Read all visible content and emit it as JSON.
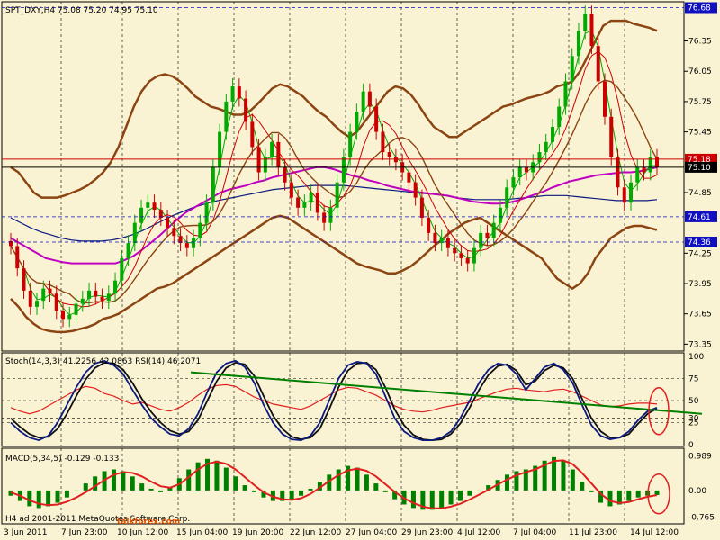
{
  "colors": {
    "background": "#FAF3D3",
    "grid": "#000000",
    "bull": "#00AA00",
    "bear": "#CC0000",
    "bollinger": "#8B4513",
    "ma_slow": "#C000C0",
    "ma_long": "#0A1A80",
    "env_red": "#E02020",
    "stoch_main": "#0A1A80",
    "stoch_signal": "#101010",
    "rsi": "#E02020",
    "trend": "#008000",
    "macd_hist": "#008000",
    "macd_signal": "#E02020",
    "level_line": "#1010C0",
    "marker": "#E02020",
    "hline_black": "#000000",
    "hline_red": "#CC0000"
  },
  "panels": {
    "main": {
      "title": "SPT_DXY,H4  75.08 75.20 74.95 75.10",
      "price_labels": [
        "76.35",
        "76.05",
        "75.75",
        "75.45",
        "74.85",
        "74.25",
        "73.95",
        "73.65",
        "73.35"
      ],
      "badges": [
        {
          "value": "76.68",
          "color": "#1010C0"
        },
        {
          "value": "75.18",
          "color": "#CC0000"
        },
        {
          "value": "75.10",
          "color": "#000000"
        },
        {
          "value": "74.61",
          "color": "#1010C0"
        },
        {
          "value": "74.36",
          "color": "#1010C0"
        }
      ]
    },
    "stoch": {
      "title": "Stoch(14,3,3) 41.2256 42.0863  RSI(14) 46.2071",
      "levels": [
        "100",
        "75",
        "50",
        "30",
        "25",
        "0"
      ]
    },
    "macd": {
      "title": "MACD(5,34,5) -0.129 -0.133",
      "levels": [
        "0.989",
        "0.00",
        "-0.765"
      ]
    }
  },
  "x_axis": {
    "labels": [
      "3 Jun 2011",
      "7 Jun 23:00",
      "10 Jun 12:00",
      "15 Jun 04:00",
      "19 Jun 20:00",
      "22 Jun 12:00",
      "27 Jun 04:00",
      "29 Jun 23:00",
      "4 Jul 12:00",
      "7 Jul 04:00",
      "11 Jul 23:00",
      "14 Jul 12:00"
    ]
  },
  "watermark": {
    "copyright": "H4    ad    2001-2011 MetaQuotes Software Corp.",
    "site": "talkforex.com"
  },
  "chart_data": {
    "type": "candlestick",
    "timeframe": "H4",
    "symbol": "SPT_DXY",
    "ohlc_last": {
      "open": 75.08,
      "high": 75.2,
      "low": 74.95,
      "close": 75.1
    },
    "ylim": [
      73.3,
      76.72
    ],
    "closes": [
      74.32,
      74.1,
      73.88,
      73.72,
      73.78,
      73.9,
      73.85,
      73.68,
      73.6,
      73.64,
      73.75,
      73.8,
      73.88,
      73.82,
      73.78,
      73.85,
      73.98,
      74.2,
      74.35,
      74.55,
      74.7,
      74.75,
      74.68,
      74.6,
      74.5,
      74.42,
      74.35,
      74.3,
      74.4,
      74.55,
      74.75,
      75.1,
      75.45,
      75.75,
      75.9,
      75.78,
      75.55,
      75.3,
      75.05,
      75.2,
      75.35,
      75.1,
      74.95,
      74.8,
      74.7,
      74.75,
      74.85,
      74.65,
      74.55,
      74.7,
      74.95,
      75.2,
      75.45,
      75.65,
      75.85,
      75.7,
      75.45,
      75.25,
      75.2,
      75.15,
      75.05,
      74.95,
      74.8,
      74.6,
      74.45,
      74.35,
      74.4,
      74.3,
      74.25,
      74.2,
      74.15,
      74.3,
      74.45,
      74.4,
      74.55,
      74.7,
      74.9,
      75.0,
      75.1,
      75.05,
      75.15,
      75.25,
      75.35,
      75.5,
      75.7,
      75.95,
      76.2,
      76.45,
      76.62,
      76.3,
      75.95,
      75.6,
      75.2,
      74.9,
      74.75,
      74.95,
      75.1,
      75.05,
      75.2,
      75.1
    ],
    "series": [
      {
        "name": "Bands upper",
        "values": [
          75.1,
          75.05,
          74.95,
          74.85,
          74.8,
          74.8,
          74.8,
          74.82,
          74.85,
          74.88,
          74.92,
          74.98,
          75.05,
          75.15,
          75.3,
          75.5,
          75.7,
          75.85,
          75.95,
          76.0,
          76.02,
          76.0,
          75.95,
          75.88,
          75.8,
          75.75,
          75.7,
          75.68,
          75.65,
          75.62,
          75.62,
          75.65,
          75.72,
          75.8,
          75.88,
          75.92,
          75.9,
          75.85,
          75.8,
          75.72,
          75.65,
          75.6,
          75.52,
          75.45,
          75.4,
          75.45,
          75.55,
          75.65,
          75.75,
          75.85,
          75.9,
          75.88,
          75.82,
          75.72,
          75.6,
          75.5,
          75.45,
          75.4,
          75.4,
          75.45,
          75.5,
          75.55,
          75.6,
          75.65,
          75.7,
          75.72,
          75.75,
          75.78,
          75.8,
          75.82,
          75.85,
          75.9,
          75.92,
          75.95,
          76.05,
          76.2,
          76.35,
          76.5,
          76.55,
          76.55,
          76.55,
          76.52,
          76.5,
          76.48,
          76.45
        ]
      },
      {
        "name": "Bands lower",
        "values": [
          73.8,
          73.72,
          73.62,
          73.55,
          73.5,
          73.48,
          73.47,
          73.47,
          73.48,
          73.5,
          73.52,
          73.55,
          73.6,
          73.62,
          73.65,
          73.7,
          73.75,
          73.8,
          73.85,
          73.9,
          73.92,
          73.95,
          74.0,
          74.05,
          74.1,
          74.15,
          74.2,
          74.25,
          74.3,
          74.35,
          74.4,
          74.45,
          74.5,
          74.55,
          74.6,
          74.62,
          74.6,
          74.55,
          74.5,
          74.45,
          74.4,
          74.35,
          74.3,
          74.25,
          74.2,
          74.15,
          74.12,
          74.1,
          74.08,
          74.05,
          74.05,
          74.08,
          74.12,
          74.18,
          74.25,
          74.32,
          74.38,
          74.45,
          74.5,
          74.55,
          74.58,
          74.6,
          74.55,
          74.5,
          74.45,
          74.4,
          74.35,
          74.3,
          74.25,
          74.2,
          74.1,
          74.0,
          73.95,
          73.9,
          73.95,
          74.05,
          74.2,
          74.3,
          74.4,
          74.45,
          74.5,
          74.52,
          74.52,
          74.5,
          74.48
        ]
      },
      {
        "name": "MA slow",
        "values": [
          74.4,
          74.35,
          74.3,
          74.25,
          74.2,
          74.18,
          74.16,
          74.15,
          74.15,
          74.15,
          74.15,
          74.15,
          74.15,
          74.18,
          74.22,
          74.28,
          74.35,
          74.42,
          74.5,
          74.58,
          74.65,
          74.7,
          74.75,
          74.8,
          74.85,
          74.88,
          74.9,
          74.92,
          74.95,
          74.97,
          75.0,
          75.02,
          75.04,
          75.06,
          75.08,
          75.1,
          75.1,
          75.08,
          75.05,
          75.02,
          75.0,
          74.97,
          74.95,
          74.92,
          74.9,
          74.88,
          74.86,
          74.85,
          74.84,
          74.83,
          74.82,
          74.8,
          74.78,
          74.76,
          74.75,
          74.74,
          74.74,
          74.75,
          74.77,
          74.8,
          74.83,
          74.86,
          74.9,
          74.93,
          74.96,
          74.98,
          75.0,
          75.02,
          75.03,
          75.04,
          75.05,
          75.05,
          75.06,
          75.08,
          75.1
        ]
      },
      {
        "name": "MA long",
        "values": [
          74.6,
          74.55,
          74.5,
          74.46,
          74.43,
          74.4,
          74.38,
          74.37,
          74.37,
          74.37,
          74.38,
          74.4,
          74.43,
          74.47,
          74.52,
          74.57,
          74.62,
          74.66,
          74.7,
          74.73,
          74.76,
          74.78,
          74.8,
          74.82,
          74.84,
          74.86,
          74.88,
          74.89,
          74.9,
          74.91,
          74.92,
          74.92,
          74.92,
          74.92,
          74.91,
          74.9,
          74.89,
          74.88,
          74.87,
          74.86,
          74.85,
          74.84,
          74.83,
          74.82,
          74.8,
          74.79,
          74.78,
          74.78,
          74.78,
          74.78,
          74.79,
          74.8,
          74.81,
          74.82,
          74.82,
          74.82,
          74.81,
          74.8,
          74.79,
          74.78,
          74.77,
          74.77,
          74.77,
          74.77,
          74.78
        ]
      },
      {
        "name": "Stochastic %K",
        "values": [
          25,
          15,
          8,
          5,
          10,
          25,
          45,
          65,
          82,
          92,
          95,
          90,
          80,
          62,
          45,
          30,
          20,
          12,
          10,
          18,
          35,
          60,
          82,
          92,
          95,
          88,
          70,
          45,
          25,
          12,
          6,
          5,
          10,
          25,
          50,
          75,
          90,
          94,
          92,
          80,
          55,
          30,
          15,
          8,
          5,
          5,
          8,
          15,
          30,
          50,
          70,
          85,
          92,
          90,
          80,
          62,
          75,
          88,
          92,
          85,
          70,
          45,
          22,
          10,
          6,
          8,
          15,
          28,
          38,
          42
        ]
      },
      {
        "name": "Stochastic %D",
        "values": [
          30,
          20,
          12,
          8,
          9,
          18,
          35,
          55,
          74,
          87,
          93,
          92,
          85,
          70,
          52,
          37,
          25,
          16,
          12,
          15,
          28,
          50,
          72,
          87,
          93,
          91,
          78,
          55,
          33,
          18,
          9,
          6,
          8,
          18,
          40,
          65,
          84,
          92,
          93,
          85,
          65,
          40,
          22,
          11,
          6,
          5,
          6,
          12,
          24,
          42,
          62,
          79,
          89,
          91,
          84,
          68,
          72,
          84,
          90,
          87,
          75,
          52,
          30,
          15,
          8,
          8,
          12,
          24,
          35,
          41
        ]
      },
      {
        "name": "RSI(14)",
        "values": [
          42,
          38,
          35,
          38,
          44,
          50,
          56,
          62,
          66,
          64,
          58,
          55,
          50,
          46,
          48,
          44,
          40,
          38,
          42,
          48,
          56,
          63,
          67,
          68,
          66,
          60,
          54,
          50,
          46,
          44,
          42,
          40,
          44,
          50,
          56,
          62,
          65,
          64,
          60,
          56,
          50,
          44,
          40,
          38,
          37,
          39,
          42,
          44,
          46,
          48,
          52,
          56,
          60,
          63,
          64,
          62,
          61,
          60,
          62,
          63,
          60,
          55,
          50,
          45,
          43,
          44,
          46,
          47,
          47,
          46
        ]
      },
      {
        "name": "MACD histogram",
        "values": [
          -0.15,
          -0.3,
          -0.45,
          -0.5,
          -0.45,
          -0.35,
          -0.2,
          0.0,
          0.2,
          0.4,
          0.55,
          0.6,
          0.55,
          0.4,
          0.2,
          0.05,
          -0.05,
          0.1,
          0.35,
          0.6,
          0.8,
          0.9,
          0.85,
          0.65,
          0.4,
          0.15,
          -0.05,
          -0.2,
          -0.3,
          -0.3,
          -0.25,
          -0.15,
          0.05,
          0.25,
          0.45,
          0.6,
          0.7,
          0.65,
          0.45,
          0.2,
          -0.05,
          -0.25,
          -0.4,
          -0.5,
          -0.55,
          -0.55,
          -0.5,
          -0.4,
          -0.3,
          -0.15,
          0.0,
          0.15,
          0.3,
          0.45,
          0.55,
          0.6,
          0.7,
          0.85,
          0.95,
          0.85,
          0.6,
          0.25,
          -0.05,
          -0.35,
          -0.45,
          -0.4,
          -0.3,
          -0.2,
          -0.15,
          -0.13
        ]
      },
      {
        "name": "MACD signal",
        "values": [
          -0.05,
          -0.15,
          -0.28,
          -0.38,
          -0.42,
          -0.4,
          -0.32,
          -0.2,
          -0.05,
          0.12,
          0.3,
          0.45,
          0.52,
          0.5,
          0.4,
          0.25,
          0.12,
          0.08,
          0.18,
          0.38,
          0.6,
          0.76,
          0.82,
          0.76,
          0.6,
          0.38,
          0.15,
          -0.05,
          -0.18,
          -0.25,
          -0.27,
          -0.22,
          -0.1,
          0.08,
          0.27,
          0.44,
          0.57,
          0.62,
          0.56,
          0.4,
          0.18,
          -0.04,
          -0.22,
          -0.36,
          -0.46,
          -0.51,
          -0.51,
          -0.46,
          -0.38,
          -0.26,
          -0.12,
          0.02,
          0.17,
          0.31,
          0.43,
          0.52,
          0.6,
          0.72,
          0.84,
          0.86,
          0.75,
          0.5,
          0.2,
          -0.1,
          -0.3,
          -0.36,
          -0.33,
          -0.25,
          -0.18,
          -0.13
        ]
      }
    ],
    "trendline_note": "green descending trendline across stochastic panel",
    "y_levels_main": [
      76.68,
      75.18,
      75.1,
      74.61,
      74.36
    ]
  }
}
